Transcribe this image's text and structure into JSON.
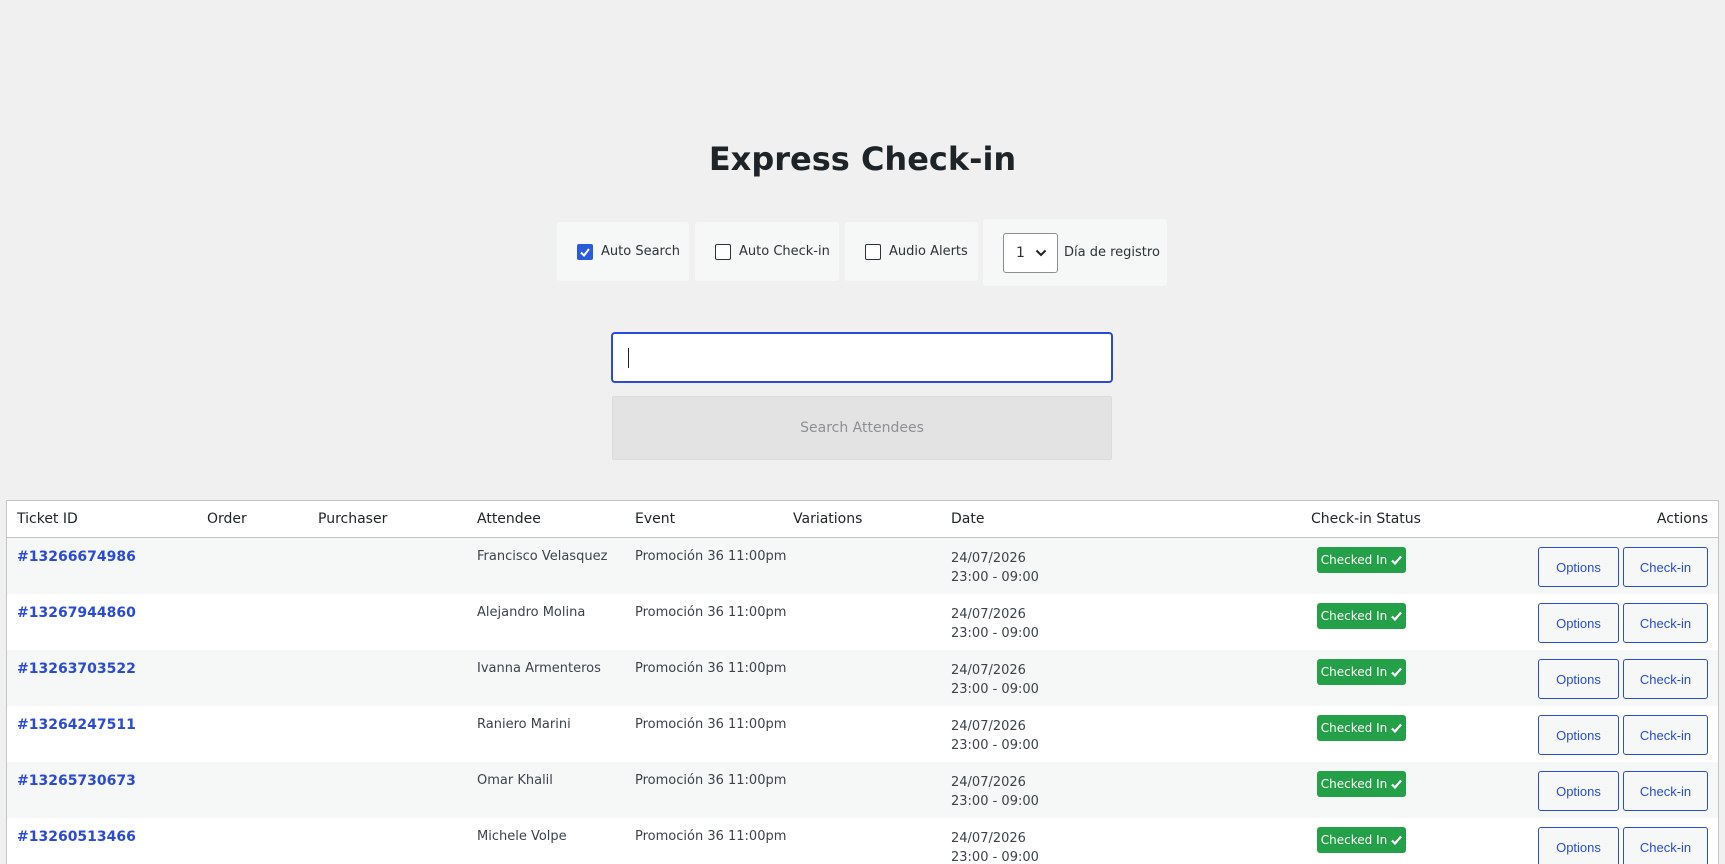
{
  "page": {
    "title": "Express Check-in"
  },
  "options": {
    "auto_search": {
      "label": "Auto Search",
      "checked": true
    },
    "auto_checkin": {
      "label": "Auto Check-in",
      "checked": false
    },
    "audio_alerts": {
      "label": "Audio Alerts",
      "checked": false
    },
    "day": {
      "value": "1",
      "label": "Día de registro"
    }
  },
  "search": {
    "value": "",
    "button_label": "Search Attendees"
  },
  "table": {
    "columns": [
      "Ticket ID",
      "Order",
      "Purchaser",
      "Attendee",
      "Event",
      "Variations",
      "Date",
      "Check-in Status",
      "Actions"
    ],
    "rows": [
      {
        "ticket_id": "#13266674986",
        "attendee": "Francisco Velasquez",
        "event": "Promoción 36 11:00pm",
        "date": "24/07/2026",
        "time": "23:00 - 09:00",
        "status": "Checked In",
        "options_label": "Options",
        "checkin_label": "Check-in"
      },
      {
        "ticket_id": "#13267944860",
        "attendee": "Alejandro Molina",
        "event": "Promoción 36 11:00pm",
        "date": "24/07/2026",
        "time": "23:00 - 09:00",
        "status": "Checked In",
        "options_label": "Options",
        "checkin_label": "Check-in"
      },
      {
        "ticket_id": "#13263703522",
        "attendee": "Ivanna Armenteros",
        "event": "Promoción 36 11:00pm",
        "date": "24/07/2026",
        "time": "23:00 - 09:00",
        "status": "Checked In",
        "options_label": "Options",
        "checkin_label": "Check-in"
      },
      {
        "ticket_id": "#13264247511",
        "attendee": "Raniero Marini",
        "event": "Promoción 36 11:00pm",
        "date": "24/07/2026",
        "time": "23:00 - 09:00",
        "status": "Checked In",
        "options_label": "Options",
        "checkin_label": "Check-in"
      },
      {
        "ticket_id": "#13265730673",
        "attendee": "Omar Khalil",
        "event": "Promoción 36 11:00pm",
        "date": "24/07/2026",
        "time": "23:00 - 09:00",
        "status": "Checked In",
        "options_label": "Options",
        "checkin_label": "Check-in"
      },
      {
        "ticket_id": "#13260513466",
        "attendee": "Michele Volpe",
        "event": "Promoción 36 11:00pm",
        "date": "24/07/2026",
        "time": "23:00 - 09:00",
        "status": "Checked In",
        "options_label": "Options",
        "checkin_label": "Check-in"
      }
    ]
  },
  "colors": {
    "accent": "#2a4ad8",
    "success": "#24a148",
    "background": "#f0f0f0"
  },
  "icons": {
    "status": "checkmark-icon",
    "select": "chevron-down-icon"
  }
}
